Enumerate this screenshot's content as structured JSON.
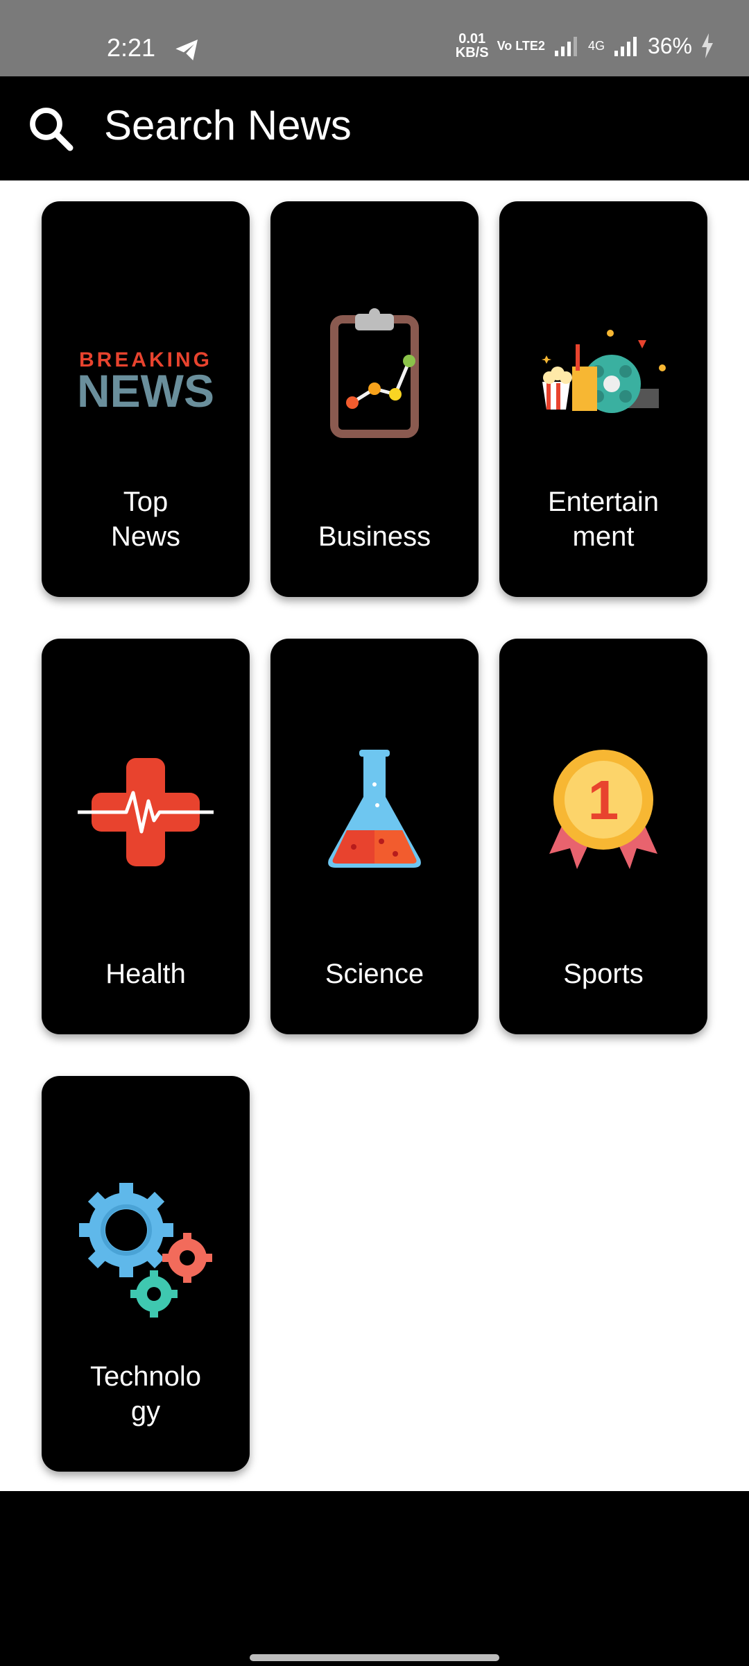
{
  "status_bar": {
    "time": "2:21",
    "netspeed_value": "0.01",
    "netspeed_unit": "KB/S",
    "volte": "Vo LTE2",
    "network": "4G",
    "battery": "36%"
  },
  "header": {
    "search_placeholder": "Search News",
    "search_icon": "search-icon"
  },
  "categories": [
    {
      "label": "Top\nNews",
      "icon": "breaking-news-icon"
    },
    {
      "label": "Business",
      "icon": "clipboard-chart-icon"
    },
    {
      "label": "Entertain\nment",
      "icon": "popcorn-film-reel-icon"
    },
    {
      "label": "Health",
      "icon": "medical-cross-heartbeat-icon"
    },
    {
      "label": "Science",
      "icon": "flask-icon"
    },
    {
      "label": "Sports",
      "icon": "medal-icon"
    },
    {
      "label": "Technolo\ngy",
      "icon": "gears-icon"
    }
  ],
  "breaking_news_icon_text": {
    "line1": "BREAKING",
    "line2": "NEWS"
  },
  "sports_medal_text": "1",
  "colors": {
    "status_bar": "#7a7a7a",
    "header_bg": "#000000",
    "card_bg": "#000000",
    "page_bg": "#ffffff"
  }
}
